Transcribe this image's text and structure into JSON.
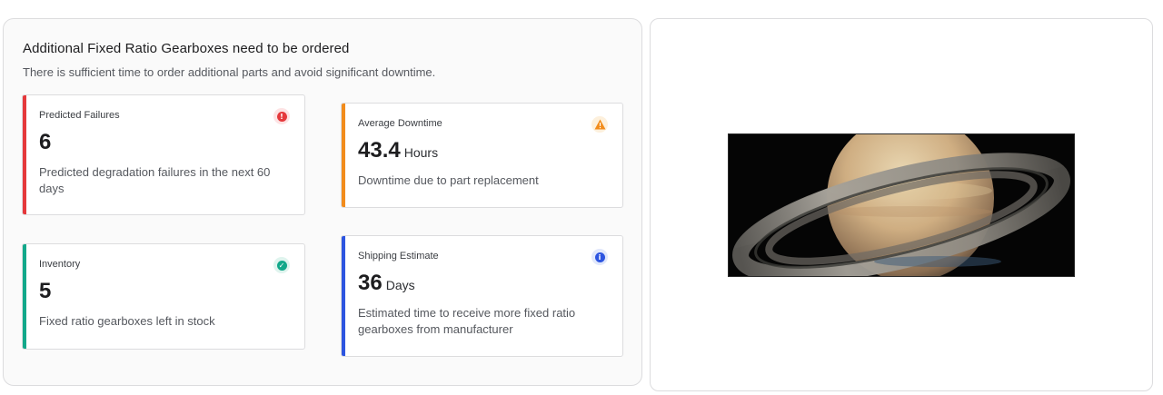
{
  "header": {
    "title": "Additional Fixed Ratio Gearboxes need to be ordered",
    "subtitle": "There is sufficient time to order additional parts and avoid significant downtime."
  },
  "cards": [
    {
      "label": "Predicted Failures",
      "value": "6",
      "unit": "",
      "description": "Predicted degradation failures in the next 60 days",
      "icon": "error-icon",
      "icon_glyph": "!",
      "accent_color": "#e5383b"
    },
    {
      "label": "Average Downtime",
      "value": "43.4",
      "unit": "Hours",
      "description": "Downtime due to part replacement",
      "icon": "warning-icon",
      "icon_glyph": "!",
      "accent_color": "#f28c1c"
    },
    {
      "label": "Inventory",
      "value": "5",
      "unit": "",
      "description": "Fixed ratio gearboxes left in stock",
      "icon": "check-icon",
      "icon_glyph": "✓",
      "accent_color": "#12a88a"
    },
    {
      "label": "Shipping Estimate",
      "value": "36",
      "unit": "Days",
      "description": "Estimated time to receive more fixed ratio gearboxes from manufacturer",
      "icon": "info-icon",
      "icon_glyph": "i",
      "accent_color": "#2d55e0"
    }
  ],
  "image": {
    "subject": "saturn-planet-image"
  }
}
